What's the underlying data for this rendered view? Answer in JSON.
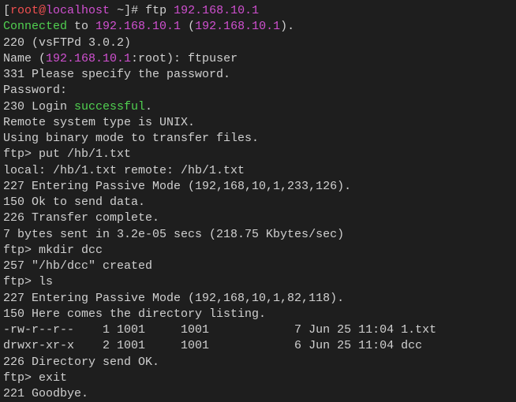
{
  "lines": {
    "l01_open": "[",
    "l01_user": "root",
    "l01_at": "@",
    "l01_host": "localhost",
    "l01_rest": " ~]# ftp ",
    "l01_ip": "192.168.10.1",
    "l02_connected": "Connected",
    "l02_to": " to ",
    "l02_ip1": "192.168.10.1",
    "l02_paren1": " (",
    "l02_ip2": "192.168.10.1",
    "l02_paren2": ").",
    "l03": "220 (vsFTPd 3.0.2)",
    "l04_a": "Name (",
    "l04_ip": "192.168.10.1",
    "l04_b": ":root): ftpuser",
    "l05": "331 Please specify the password.",
    "l06": "Password:",
    "l07_a": "230 Login ",
    "l07_b": "successful",
    "l07_c": ".",
    "l08": "Remote system type is UNIX.",
    "l09": "Using binary mode to transfer files.",
    "l10": "ftp> put /hb/1.txt",
    "l11": "local: /hb/1.txt remote: /hb/1.txt",
    "l12": "227 Entering Passive Mode (192,168,10,1,233,126).",
    "l13": "150 Ok to send data.",
    "l14": "226 Transfer complete.",
    "l15": "7 bytes sent in 3.2e-05 secs (218.75 Kbytes/sec)",
    "l16": "ftp> mkdir dcc",
    "l17": "257 \"/hb/dcc\" created",
    "l18": "ftp> ls",
    "l19": "227 Entering Passive Mode (192,168,10,1,82,118).",
    "l20": "150 Here comes the directory listing.",
    "l21": "-rw-r--r--    1 1001     1001            7 Jun 25 11:04 1.txt",
    "l22": "drwxr-xr-x    2 1001     1001            6 Jun 25 11:04 dcc",
    "l23": "226 Directory send OK.",
    "l24": "ftp> exit",
    "l25": "221 Goodbye."
  }
}
